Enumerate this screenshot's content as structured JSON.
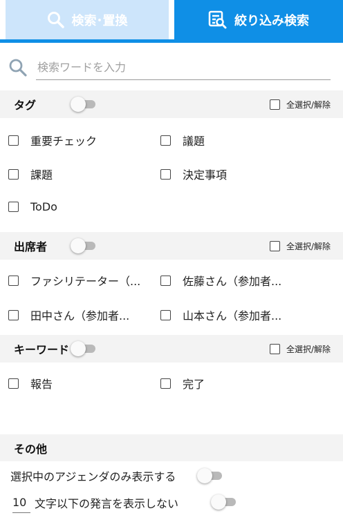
{
  "tabs": {
    "search_replace": "検索･置換",
    "filter_search": "絞り込み検索"
  },
  "search": {
    "placeholder": "検索ワードを入力"
  },
  "tags": {
    "title": "タグ",
    "select_all": "全選択/解除",
    "items": [
      "重要チェック",
      "議題",
      "課題",
      "決定事項",
      "ToDo"
    ]
  },
  "attendees": {
    "title": "出席者",
    "select_all": "全選択/解除",
    "items": [
      "ファシリテーター（...",
      "佐藤さん（参加者...",
      "田中さん（参加者...",
      "山本さん（参加者..."
    ]
  },
  "keywords": {
    "title": "キーワード",
    "select_all": "全選択/解除",
    "items": [
      "報告",
      "完了"
    ]
  },
  "other": {
    "title": "その他",
    "agenda_only_label": "選択中のアジェンダのみ表示する",
    "min_chars_value": "10",
    "min_chars_label": "文字以下の発言を表示しない"
  },
  "colors": {
    "accent": "#0f8fe6",
    "tab_inactive": "#cde5fb",
    "section_bg": "#f3f3f3"
  }
}
